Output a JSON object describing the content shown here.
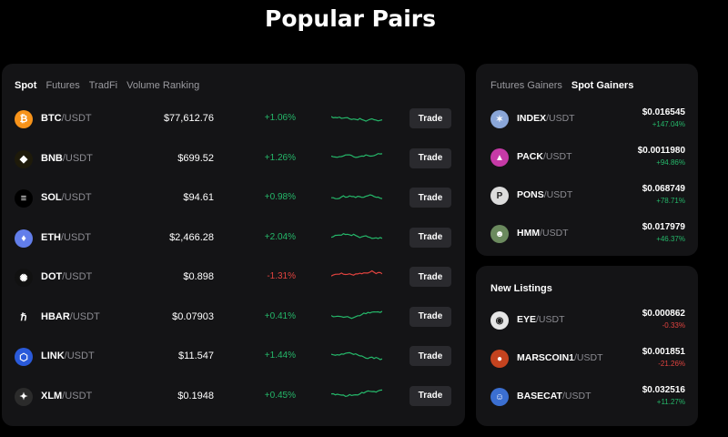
{
  "title": "Popular Pairs",
  "main_tabs": [
    "Spot",
    "Futures",
    "TradFi",
    "Volume Ranking"
  ],
  "trade_label": "Trade",
  "pairs": [
    {
      "base": "BTC",
      "quote": "/USDT",
      "price": "$77,612.76",
      "change": "+1.06%",
      "dir": "up",
      "icon": "bitcoin-icon",
      "color": "#f7931a",
      "glyph": "₿"
    },
    {
      "base": "BNB",
      "quote": "/USDT",
      "price": "$699.52",
      "change": "+1.26%",
      "dir": "up",
      "icon": "bnb-icon",
      "color": "#1e1a0a",
      "glyph": "◆"
    },
    {
      "base": "SOL",
      "quote": "/USDT",
      "price": "$94.61",
      "change": "+0.98%",
      "dir": "up",
      "icon": "solana-icon",
      "color": "#000000",
      "glyph": "≡"
    },
    {
      "base": "ETH",
      "quote": "/USDT",
      "price": "$2,466.28",
      "change": "+2.04%",
      "dir": "up",
      "icon": "ethereum-icon",
      "color": "#627eea",
      "glyph": "♦"
    },
    {
      "base": "DOT",
      "quote": "/USDT",
      "price": "$0.898",
      "change": "-1.31%",
      "dir": "down",
      "icon": "polkadot-icon",
      "color": "#111111",
      "glyph": "✺"
    },
    {
      "base": "HBAR",
      "quote": "/USDT",
      "price": "$0.07903",
      "change": "+0.41%",
      "dir": "up",
      "icon": "hedera-icon",
      "color": "#141416",
      "glyph": "ℏ"
    },
    {
      "base": "LINK",
      "quote": "/USDT",
      "price": "$11.547",
      "change": "+1.44%",
      "dir": "up",
      "icon": "chainlink-icon",
      "color": "#2a5ada",
      "glyph": "⬡"
    },
    {
      "base": "XLM",
      "quote": "/USDT",
      "price": "$0.1948",
      "change": "+0.45%",
      "dir": "up",
      "icon": "stellar-icon",
      "color": "#2b2b2b",
      "glyph": "✦"
    }
  ],
  "side_tabs": [
    "Futures Gainers",
    "Spot Gainers"
  ],
  "gainers": [
    {
      "base": "INDEX",
      "quote": "/USDT",
      "price": "$0.016545",
      "change": "+147.04%",
      "dir": "up",
      "icon": "index-token-icon",
      "color": "#8aa6d8",
      "glyph": "✶"
    },
    {
      "base": "PACK",
      "quote": "/USDT",
      "price": "$0.0011980",
      "change": "+94.86%",
      "dir": "up",
      "icon": "pack-token-icon",
      "color": "#c63aa7",
      "glyph": "▲"
    },
    {
      "base": "PONS",
      "quote": "/USDT",
      "price": "$0.068749",
      "change": "+78.71%",
      "dir": "up",
      "icon": "pons-token-icon",
      "color": "#dcdcdc",
      "glyph": "P"
    },
    {
      "base": "HMM",
      "quote": "/USDT",
      "price": "$0.017979",
      "change": "+46.37%",
      "dir": "up",
      "icon": "hmm-token-icon",
      "color": "#6b8a5e",
      "glyph": "☻"
    }
  ],
  "new_listings_title": "New Listings",
  "new_listings": [
    {
      "base": "EYE",
      "quote": "/USDT",
      "price": "$0.000862",
      "change": "-0.33%",
      "dir": "down",
      "icon": "eye-token-icon",
      "color": "#e6e6e6",
      "glyph": "◉"
    },
    {
      "base": "MARSCOIN1",
      "quote": "/USDT",
      "price": "$0.001851",
      "change": "-21.26%",
      "dir": "down",
      "icon": "marscoin-token-icon",
      "color": "#c4431f",
      "glyph": "●"
    },
    {
      "base": "BASECAT",
      "quote": "/USDT",
      "price": "$0.032516",
      "change": "+11.27%",
      "dir": "up",
      "icon": "basecat-token-icon",
      "color": "#3b6fd1",
      "glyph": "☺"
    }
  ],
  "colors": {
    "up": "#25b86a",
    "down": "#e2433f",
    "panel": "#141416",
    "button": "#2a2a2e"
  }
}
